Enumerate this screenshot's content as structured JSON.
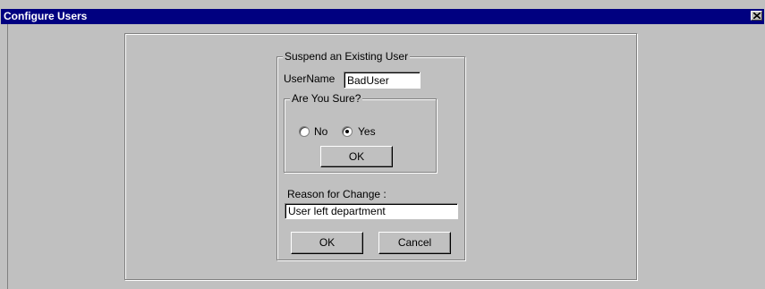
{
  "window": {
    "title": "Configure Users",
    "close_icon": "close-icon"
  },
  "suspend_group": {
    "legend": "Suspend an Existing User",
    "username_label": "UserName",
    "username_value": "BadUser"
  },
  "confirm_group": {
    "legend": "Are You Sure?",
    "options": [
      {
        "label": "No",
        "selected": false
      },
      {
        "label": "Yes",
        "selected": true
      }
    ],
    "ok_label": "OK"
  },
  "reason": {
    "label": "Reason for Change :",
    "value": "User left department"
  },
  "actions": {
    "ok_label": "OK",
    "cancel_label": "Cancel"
  }
}
